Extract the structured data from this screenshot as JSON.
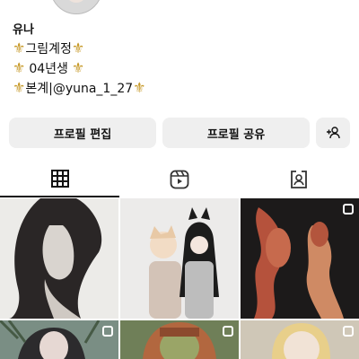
{
  "profile": {
    "name": "유나",
    "bio": [
      {
        "pre": "⚜️",
        "text": "그림계정",
        "post": "⚜️"
      },
      {
        "pre": "⚜️",
        "text": " 04년생 ",
        "post": "⚜️"
      },
      {
        "pre": "⚜️",
        "text": "본계|@yuna_1_27 ",
        "post": "⚜️"
      }
    ]
  },
  "actions": {
    "edit_label": "프로필 편집",
    "share_label": "프로필 공유",
    "add_icon": "add-person-icon"
  },
  "tabs": [
    {
      "icon": "grid-icon",
      "active": true
    },
    {
      "icon": "reels-icon",
      "active": false
    },
    {
      "icon": "tagged-icon",
      "active": false
    }
  ],
  "posts": [
    {
      "subject": "long-haired-woman-sketch",
      "multi": false
    },
    {
      "subject": "cat-eared-couple-drawing",
      "multi": false
    },
    {
      "subject": "goldfish-drawing",
      "multi": true
    },
    {
      "subject": "girl-with-leaves",
      "multi": true
    },
    {
      "subject": "girl-with-bangs",
      "multi": true
    },
    {
      "subject": "blonde-woman",
      "multi": true
    }
  ]
}
